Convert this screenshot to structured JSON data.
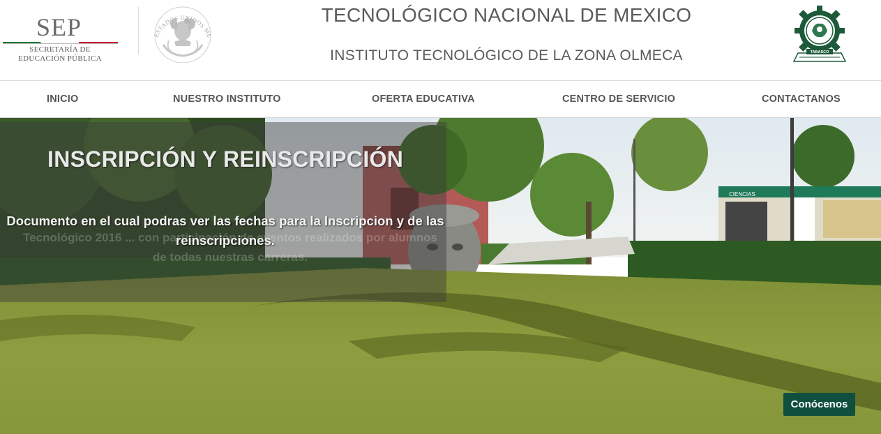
{
  "header": {
    "sep_word": "SEP",
    "sep_line1": "SECRETARÍA DE",
    "sep_line2": "EDUCACIÓN PÚBLICA",
    "title": "TECNOLÓGICO NACIONAL DE MEXICO",
    "subtitle": "INSTITUTO TECNOLÓGICO DE LA ZONA OLMECA",
    "escudo_text": "ESTADOS UNIDOS MEXICANOS",
    "logo_text": "TABASCO"
  },
  "nav": {
    "items": [
      {
        "label": "INICIO"
      },
      {
        "label": "NUESTRO INSTITUTO"
      },
      {
        "label": "OFERTA EDUCATIVA"
      },
      {
        "label": "CENTRO DE SERVICIO"
      },
      {
        "label": "CONTACTANOS"
      }
    ]
  },
  "hero": {
    "title": "INSCRIPCIÓN Y REINSCRIPCIÓN",
    "description": "Documento en el cual podras ver las fechas para la Inscripcion y de las reinscripciones.",
    "ghost_text": "Tecnológico 2016 ... con participación de eventos realizados por alumnos de todas nuestras carreras.",
    "cta_label": "Conócenos",
    "building_sign": "CIENCIAS"
  },
  "colors": {
    "accent": "#0f4f3e",
    "grass": "#8a9a3c",
    "text": "#555555"
  }
}
